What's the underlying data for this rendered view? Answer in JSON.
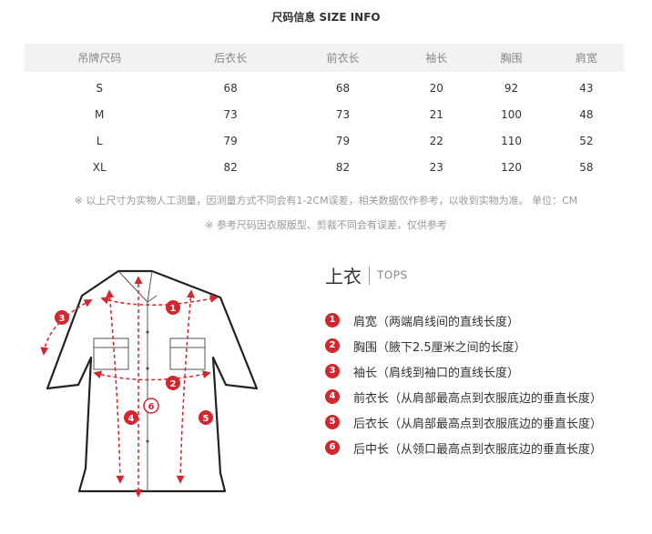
{
  "title": "尺码信息 SIZE INFO",
  "table": {
    "headers": [
      "吊牌尺码",
      "后衣长",
      "前衣长",
      "袖长",
      "胸围",
      "肩宽"
    ],
    "rows": [
      [
        "S",
        "68",
        "68",
        "20",
        "92",
        "43"
      ],
      [
        "M",
        "73",
        "73",
        "21",
        "100",
        "48"
      ],
      [
        "L",
        "79",
        "79",
        "22",
        "110",
        "52"
      ],
      [
        "XL",
        "82",
        "82",
        "23",
        "120",
        "58"
      ]
    ]
  },
  "notes": [
    "※ 以上尺寸为实物人工测量，因测量方式不同会有1-2CM误差，相关数据仅作参考，以收到实物为准。 单位：CM",
    "※ 参考尺码因衣服版型、剪裁不同会有误差，仅供参考"
  ],
  "tops": {
    "title_zh": "上衣",
    "title_en": "TOPS"
  },
  "diagram_labels": [
    "1",
    "2",
    "3",
    "4",
    "5",
    "6"
  ],
  "legend": [
    {
      "num": "1",
      "text": "肩宽（两端肩线间的直线长度）"
    },
    {
      "num": "2",
      "text": "胸围（腋下2.5厘米之间的长度）"
    },
    {
      "num": "3",
      "text": "袖长（肩线到袖口的直线长度）"
    },
    {
      "num": "4",
      "text": "前衣长（从肩部最高点到衣服底边的垂直长度）"
    },
    {
      "num": "5",
      "text": "后衣长（从肩部最高点到衣服底边的垂直长度）"
    },
    {
      "num": "6",
      "text": "后中长（从领口最高点到衣服底边的垂直长度）"
    }
  ],
  "colors": {
    "accent": "#d4262c",
    "header_bg": "#f2f2f2"
  }
}
